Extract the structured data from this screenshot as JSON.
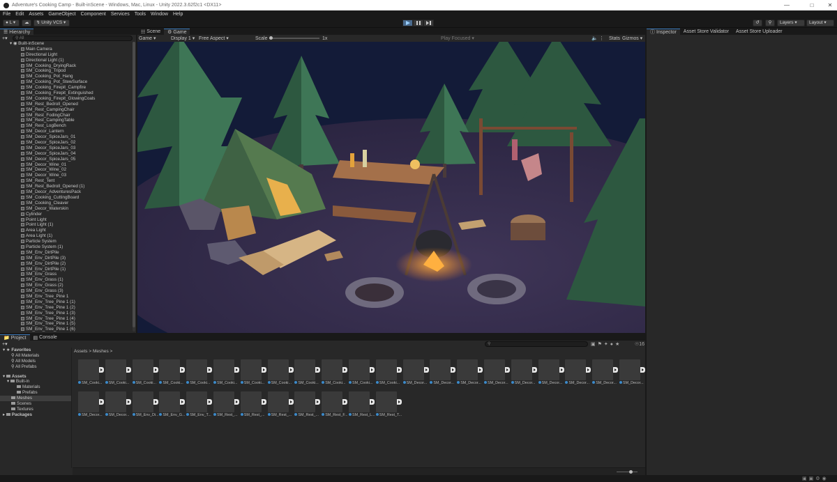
{
  "window": {
    "title": "Adventure's Cooking Camp - Built-inScene - Windows, Mac, Linux - Unity 2022.3.62f2c1 <DX11>"
  },
  "menu": [
    "File",
    "Edit",
    "Assets",
    "GameObject",
    "Component",
    "Services",
    "Tools",
    "Window",
    "Help"
  ],
  "toolbar": {
    "account": "L",
    "vcs": "Unity VCS",
    "layers": "Layers",
    "layout": "Layout"
  },
  "hierarchy": {
    "tab": "Hierarchy",
    "search_placeholder": "All",
    "scene": "Built-inScene",
    "items": [
      "Main Camera",
      "Directional Light",
      "Directional Light (1)",
      "SM_Cooking_DryingRack",
      "SM_Cooking_Tripod",
      "SM_Cooking_Pot_Hang",
      "SM_Cooking_Pot_StewSurface",
      "SM_Cooking_Firepit_Campfire",
      "SM_Cooking_Firepit_Extinguished",
      "SM_Cooking_Firepit_GlowingCoals",
      "SM_Rest_Bedroll_Opened",
      "SM_Rest_CampingChair",
      "SM_Rest_FodingChair",
      "SM_Rest_CampingTable",
      "SM_Rest_LogBench",
      "SM_Decor_Lantern",
      "SM_Decor_SpiceJars_01",
      "SM_Decor_SpiceJars_02",
      "SM_Decor_SpiceJars_03",
      "SM_Decor_SpiceJars_04",
      "SM_Decor_SpiceJars_05",
      "SM_Decor_Wine_01",
      "SM_Decor_Wine_02",
      "SM_Decor_Wine_03",
      "SM_Rest_Tent",
      "SM_Rest_Bedroll_Opened (1)",
      "SM_Decor_AdventuresPack",
      "SM_Cooking_CuttingBoard",
      "SM_Cooking_Cleaver",
      "SM_Decor_Waterskin",
      "Cylinder",
      "Point Light",
      "Point Light (1)",
      "Area Light",
      "Area Light (1)",
      "Particle System",
      "Particle System (1)",
      "SM_Env_DirtPile",
      "SM_Env_DirtPile (3)",
      "SM_Env_DirtPile (2)",
      "SM_Env_DirtPile (1)",
      "SM_Env_Grass",
      "SM_Env_Grass (1)",
      "SM_Env_Grass (2)",
      "SM_Env_Grass (3)",
      "SM_Env_Tree_Pine 1",
      "SM_Env_Tree_Pine 1 (1)",
      "SM_Env_Tree_Pine 1 (2)",
      "SM_Env_Tree_Pine 1 (3)",
      "SM_Env_Tree_Pine 1 (4)",
      "SM_Env_Tree_Pine 1 (5)",
      "SM_Env_Tree_Pine 1 (6)"
    ]
  },
  "view": {
    "tabs": [
      "Scene",
      "Game"
    ],
    "game_dropdown": "Game",
    "display": "Display 1",
    "aspect": "Free Aspect",
    "scale_label": "Scale",
    "scale_value": "1x",
    "play_focused": "Play Focused",
    "stats": "Stats",
    "gizmos": "Gizmos"
  },
  "inspector": {
    "tabs": [
      "Inspector",
      "Asset Store Validator",
      "Asset Store Uploader"
    ]
  },
  "project": {
    "tabs": [
      "Project",
      "Console"
    ],
    "breadcrumb": [
      "Assets",
      "Meshes"
    ],
    "count": "16",
    "favorites": {
      "label": "Favorites",
      "items": [
        "All Materials",
        "All Models",
        "All Prefabs"
      ]
    },
    "assets": {
      "label": "Assets",
      "builtin": "Built-in",
      "builtin_children": [
        "Materials",
        "Prefabs"
      ],
      "children": [
        "Meshes",
        "Scenes",
        "Textures"
      ]
    },
    "packages": "Packages",
    "tiles_row1": [
      "SM_Cooki...",
      "SM_Cooki...",
      "SM_Cooki...",
      "SM_Cooki...",
      "SM_Cooki...",
      "SM_Cooki...",
      "SM_Cooki...",
      "SM_Cooki...",
      "SM_Cooki...",
      "SM_Cooki...",
      "SM_Cooki...",
      "SM_Cooki...",
      "SM_Decor...",
      "SM_Decor...",
      "SM_Decor...",
      "SM_Decor...",
      "SM_Decor...",
      "SM_Decor...",
      "SM_Decor...",
      "SM_Decor...",
      "SM_Decor..."
    ],
    "tiles_row2": [
      "SM_Decor...",
      "SM_Decor...",
      "SM_Env_Di...",
      "SM_Env_G...",
      "SM_Env_T...",
      "SM_Rest_...",
      "SM_Rest_...",
      "SM_Rest_...",
      "SM_Rest_...",
      "SM_Rest_F...",
      "SM_Rest_L...",
      "SM_Rest_T..."
    ]
  },
  "colors": {
    "accent": "#3a79bb",
    "bg": "#191919",
    "panel": "#282828"
  }
}
